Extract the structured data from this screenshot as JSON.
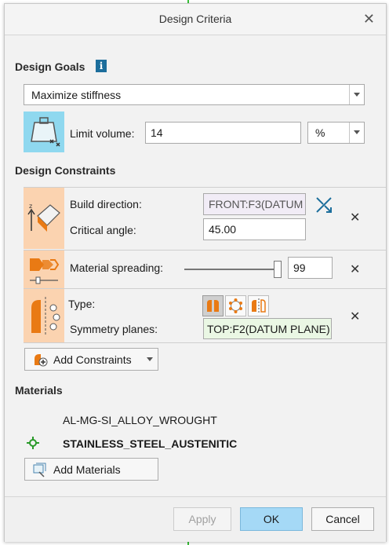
{
  "dialog": {
    "title": "Design Criteria"
  },
  "design_goals": {
    "title": "Design Goals",
    "goal_value": "Maximize stiffness",
    "limit_volume_label": "Limit volume:",
    "limit_volume_value": "14",
    "limit_unit": "%"
  },
  "design_constraints": {
    "title": "Design Constraints",
    "build_direction_label": "Build direction:",
    "build_direction_value": "FRONT:F3(DATUM",
    "critical_angle_label": "Critical angle:",
    "critical_angle_value": "45.00",
    "material_spreading_label": "Material spreading:",
    "material_spreading_value": "99",
    "material_spreading_level": 0.99,
    "type_label": "Type:",
    "symmetry_planes_label": "Symmetry planes:",
    "symmetry_planes_value": "TOP:F2(DATUM PLANE)",
    "add_constraints_label": "Add Constraints"
  },
  "materials": {
    "title": "Materials",
    "items": [
      "AL-MG-SI_ALLOY_WROUGHT",
      "STAINLESS_STEEL_AUSTENITIC"
    ],
    "add_materials_label": "Add Materials"
  },
  "footer": {
    "apply": "Apply",
    "ok": "OK",
    "cancel": "Cancel"
  },
  "colors": {
    "accent": "#a5d9f6",
    "constraint_cell": "#fbd3b0",
    "goal_icon_bg": "#8fd8ef",
    "symmetry_field": "#eaf7e4"
  }
}
